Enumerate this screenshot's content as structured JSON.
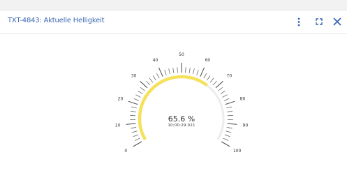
{
  "widget": {
    "title": "TXT-4843: Aktuelle Helligkeit",
    "icons": {
      "menu": "vertical-ellipsis-icon",
      "expand": "expand-icon",
      "close": "close-icon"
    },
    "accent_color": "#3a67b2"
  },
  "gauge": {
    "value_text": "65.6 %",
    "timestamp": "10:00:29.021",
    "value": 65.6,
    "min": 0,
    "max": 100,
    "tick_labels": [
      "0",
      "10",
      "20",
      "30",
      "40",
      "50",
      "60",
      "70",
      "80",
      "90",
      "100"
    ],
    "fill_color": "#f5e15c",
    "track_color": "#ececec",
    "tick_color": "#555555"
  }
}
